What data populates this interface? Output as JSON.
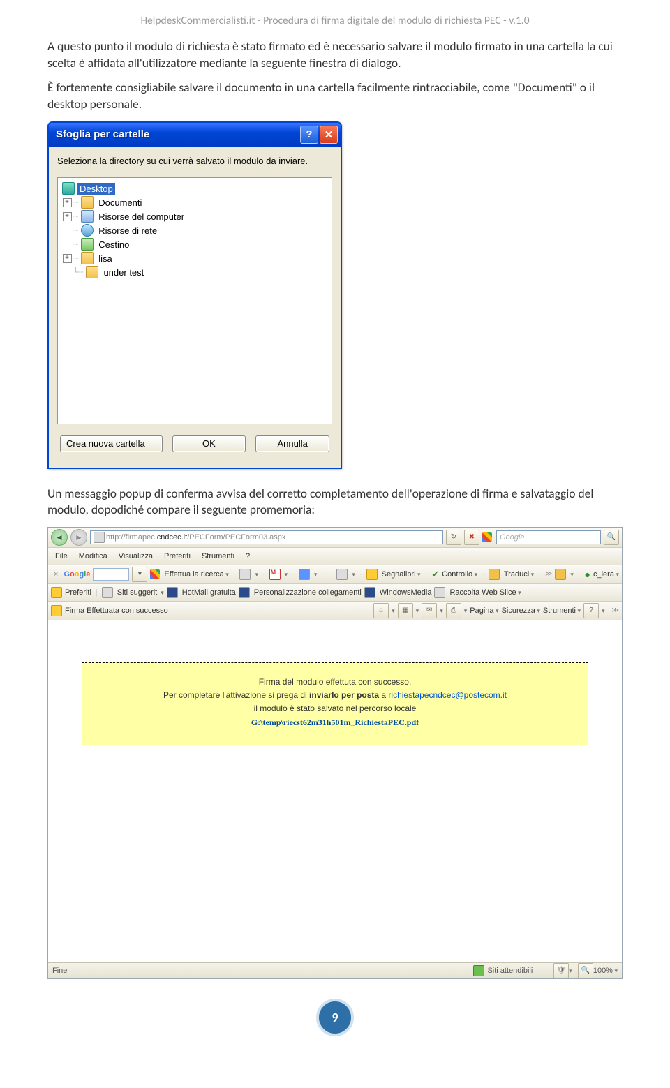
{
  "header": "HelpdeskCommercialisti.it - Procedura di firma digitale del modulo di richiesta PEC - v.1.0",
  "para1": "A questo punto il modulo di richiesta è stato firmato ed è necessario salvare il modulo firmato in una cartella la cui scelta è affidata all'utilizzatore mediante la seguente finestra di dialogo.",
  "para2": "È fortemente consigliabile salvare il documento in una cartella facilmente rintracciabile, come \"Documenti\" o il desktop personale.",
  "dialog": {
    "title": "Sfoglia per cartelle",
    "instruction": "Seleziona la directory su cui verrà salvato il modulo da inviare.",
    "tree": {
      "root": "Desktop",
      "items": [
        {
          "label": "Documenti",
          "icon": "folder",
          "exp": true
        },
        {
          "label": "Risorse del computer",
          "icon": "computer",
          "exp": true
        },
        {
          "label": "Risorse di rete",
          "icon": "network",
          "exp": false
        },
        {
          "label": "Cestino",
          "icon": "recycle",
          "exp": false
        },
        {
          "label": "lisa",
          "icon": "folder",
          "exp": true
        },
        {
          "label": "under test",
          "icon": "folder",
          "exp": false
        }
      ]
    },
    "buttons": {
      "create": "Crea nuova cartella",
      "ok": "OK",
      "cancel": "Annulla"
    }
  },
  "para3": "Un messaggio popup di conferma avvisa del corretto completamento dell'operazione di firma e salvataggio del modulo, dopodiché compare il seguente promemoria:",
  "browser": {
    "url_prefix": "http://firmapec.",
    "url_bold": "cndcec.it",
    "url_suffix": "/PECForm/PECForm03.aspx",
    "search_placeholder": "Google",
    "menu": [
      "File",
      "Modifica",
      "Visualizza",
      "Preferiti",
      "Strumenti",
      "?"
    ],
    "google_row": {
      "label": "Google",
      "search_btn": "Effettua la ricerca",
      "links": "Segnalibri",
      "controllo": "Controllo",
      "traduci": "Traduci",
      "user": "c_iera"
    },
    "fav_row": {
      "pref": "Preferiti",
      "sugg": "Siti suggeriti",
      "hotmail": "HotMail gratuita",
      "pers": "Personalizzazione collegamenti",
      "wm": "WindowsMedia",
      "slice": "Raccolta Web Slice"
    },
    "tab_row": {
      "tab": "Firma Effettuata con successo",
      "page": "Pagina",
      "sec": "Sicurezza",
      "tools": "Strumenti"
    },
    "notice": {
      "line1": "Firma del modulo effettuta con successo.",
      "line2a": "Per completare l'attivazione si prega di ",
      "line2b": "inviarlo per posta",
      "line2c": " a ",
      "email": "richiestapecndcec@postecom.it",
      "line3": "il modulo è stato salvato nel percorso locale",
      "path": "G:\\temp\\riecst62m31h501m_RichiestaPEC.pdf"
    },
    "status": {
      "left": "Fine",
      "trusted": "Siti attendibili",
      "zoom": "100%"
    }
  },
  "page_number": "9"
}
